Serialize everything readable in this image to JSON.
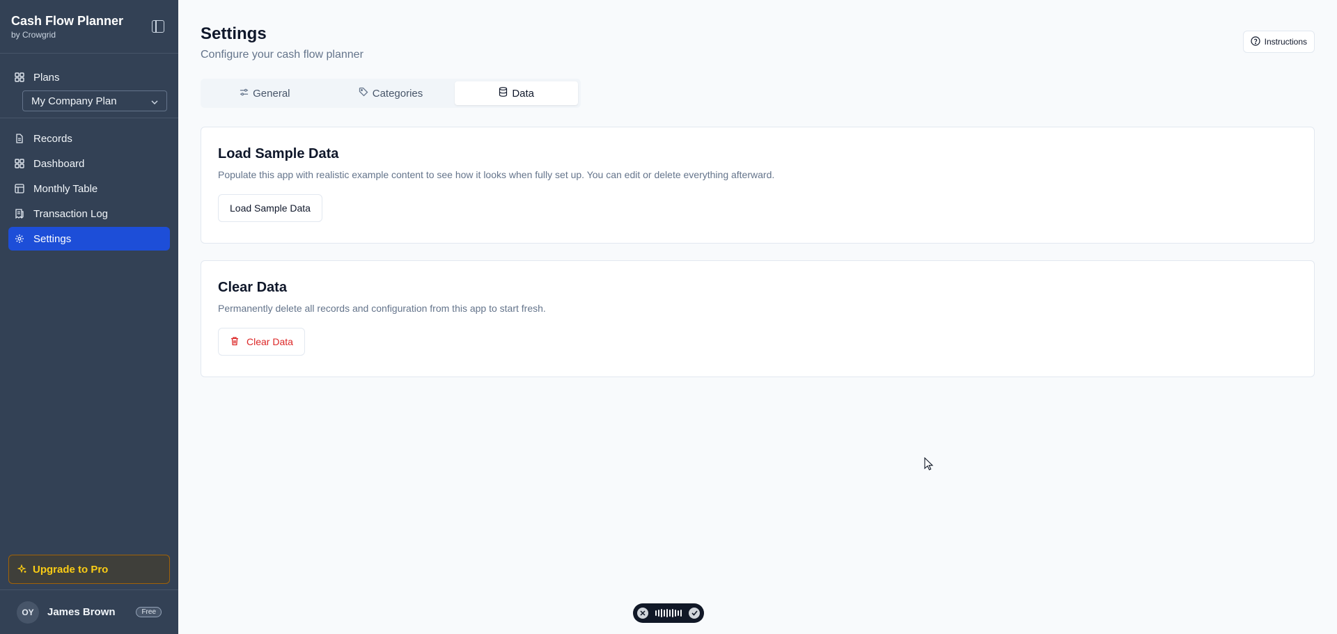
{
  "sidebar": {
    "title": "Cash Flow Planner",
    "subtitle": "by Crowgrid",
    "plans_label": "Plans",
    "plan_selected": "My Company Plan",
    "items": [
      {
        "label": "Records",
        "icon": "file-text-icon"
      },
      {
        "label": "Dashboard",
        "icon": "layout-grid-icon"
      },
      {
        "label": "Monthly Table",
        "icon": "table-icon"
      },
      {
        "label": "Transaction Log",
        "icon": "receipt-icon"
      },
      {
        "label": "Settings",
        "icon": "gear-icon",
        "active": true
      }
    ],
    "upgrade_label": "Upgrade to Pro",
    "user": {
      "initials": "OY",
      "name": "James Brown",
      "plan": "Free"
    }
  },
  "header": {
    "title": "Settings",
    "subtitle": "Configure your cash flow planner",
    "instructions_label": "Instructions"
  },
  "tabs": [
    {
      "label": "General",
      "icon": "sliders-icon"
    },
    {
      "label": "Categories",
      "icon": "tag-icon"
    },
    {
      "label": "Data",
      "icon": "database-icon",
      "active": true
    }
  ],
  "cards": {
    "load": {
      "title": "Load Sample Data",
      "description": "Populate this app with realistic example content to see how it looks when fully set up. You can edit or delete everything afterward.",
      "button": "Load Sample Data"
    },
    "clear": {
      "title": "Clear Data",
      "description": "Permanently delete all records and configuration from this app to start fresh.",
      "button": "Clear Data"
    }
  },
  "colors": {
    "sidebar_bg": "#334155",
    "active_nav": "#1d4ed8",
    "upgrade_text": "#facc15",
    "danger": "#dc2626",
    "page_bg": "#f8fafc"
  }
}
